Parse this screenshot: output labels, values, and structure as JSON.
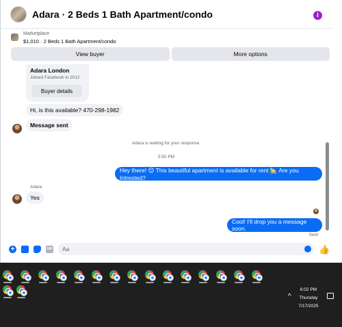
{
  "header": {
    "title": "Adara · 2 Beds 1 Bath Apartment/condo",
    "info_icon": "info-icon",
    "accent": "#9d1fd4"
  },
  "listing": {
    "label": "Marketplace",
    "item": "$1,010 · 2 Beds 1 Bath Apartment/condo"
  },
  "actions": {
    "view_buyer": "View buyer",
    "more_options": "More options"
  },
  "profile_card": {
    "name": "Adara London",
    "joined": "Joined Facebook in 2012",
    "details_button": "Buyer details"
  },
  "messages": [
    {
      "direction": "in",
      "text": "Hi, is this available? 470-298-1982"
    },
    {
      "direction": "in",
      "text": "Message sent"
    },
    {
      "direction": "system",
      "text": "Adara is waiting for your response."
    },
    {
      "direction": "time",
      "text": "5:50 PM"
    },
    {
      "direction": "out",
      "text": "Hey there! 😊 This beautiful apartment is available for rent 🏡 Are you Intrested?"
    },
    {
      "direction": "sender",
      "text": "Adara"
    },
    {
      "direction": "in",
      "text": "Yes"
    },
    {
      "direction": "out",
      "text": "Cool! I'll drop you a message soon."
    },
    {
      "direction": "status",
      "text": "Sent"
    }
  ],
  "composer": {
    "placeholder": "Aa",
    "icons": [
      "plus-circle-icon",
      "photo-icon",
      "sticker-icon",
      "gif-icon",
      "emoji-icon",
      "thumbs-up-icon"
    ]
  },
  "taskbar": {
    "app_icon": "chrome-icon",
    "time": "6:02 PM",
    "day": "Thursday",
    "date": "7/17/2025"
  },
  "colors": {
    "outgoing_bubble": "#0a6cf5",
    "incoming_bubble": "#f0f2f5",
    "taskbar": "#1f1f1f"
  }
}
